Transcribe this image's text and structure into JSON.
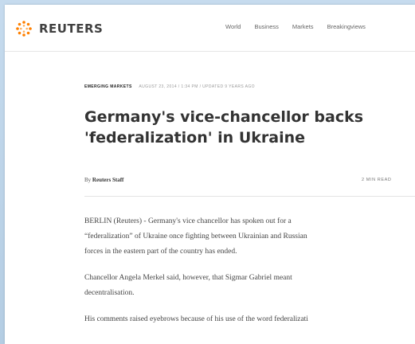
{
  "brand": {
    "name": "REUTERS",
    "logo_color": "#ff8000"
  },
  "nav": {
    "items": [
      "World",
      "Business",
      "Markets",
      "Breakingviews"
    ]
  },
  "article": {
    "section": "EMERGING MARKETS",
    "dateline": "AUGUST 23, 2014 / 1:34 PM / UPDATED 9 YEARS AGO",
    "headline_line1": "Germany's vice-chancellor backs",
    "headline_line2": "'federalization' in Ukraine",
    "byline_prefix": "By",
    "author": "Reuters Staff",
    "read_time": "2 MIN READ",
    "paragraphs": [
      [
        "BERLIN (Reuters) - Germany's vice chancellor has spoken out for a",
        "“federalization” of Ukraine once fighting between Ukrainian and Russian",
        "forces in the eastern part of the country has ended."
      ],
      [
        "Chancellor Angela Merkel said, however, that Sigmar Gabriel meant",
        "decentralisation."
      ],
      [
        "His comments raised eyebrows because of his use of the word federalizati"
      ]
    ]
  }
}
